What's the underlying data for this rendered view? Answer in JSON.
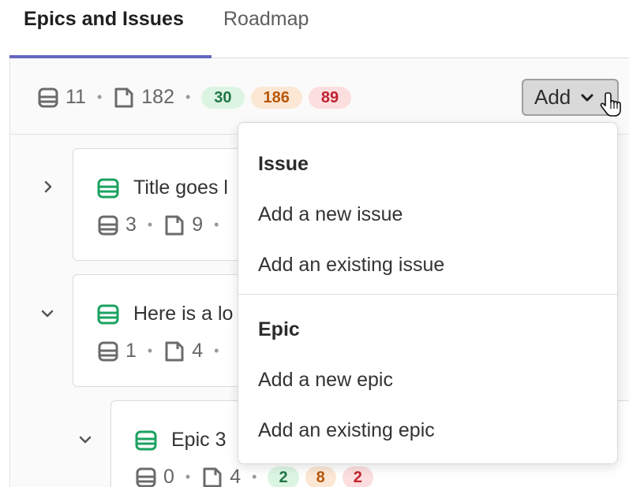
{
  "tabs": {
    "active": "Epics and Issues",
    "inactive": "Roadmap"
  },
  "summary": {
    "epics_count": "11",
    "issues_count": "182",
    "badges": {
      "green": "30",
      "orange": "186",
      "red": "89"
    }
  },
  "add_button": {
    "label": "Add"
  },
  "items": [
    {
      "title": "Title goes l",
      "epics": "3",
      "issues": "9",
      "expanded": false
    },
    {
      "title": "Here is a lo",
      "epics": "1",
      "issues": "4",
      "expanded": true
    },
    {
      "title": "Epic 3",
      "epics": "0",
      "issues": "4",
      "badges": {
        "green": "2",
        "orange": "8",
        "red": "2"
      },
      "expanded": true
    }
  ],
  "dropdown": {
    "issue_header": "Issue",
    "add_new_issue": "Add a new issue",
    "add_existing_issue": "Add an existing issue",
    "epic_header": "Epic",
    "add_new_epic": "Add a new epic",
    "add_existing_epic": "Add an existing epic"
  },
  "colors": {
    "tab_underline": "#6666c4",
    "epic_icon": "#1aa260",
    "badge_green_bg": "#dcf5e3",
    "badge_orange_bg": "#fbe7d4",
    "badge_red_bg": "#fcdede"
  },
  "icons": [
    "epic-icon",
    "issue-icon",
    "chevron-right-icon",
    "chevron-down-icon",
    "hand-pointer-cursor-icon"
  ]
}
